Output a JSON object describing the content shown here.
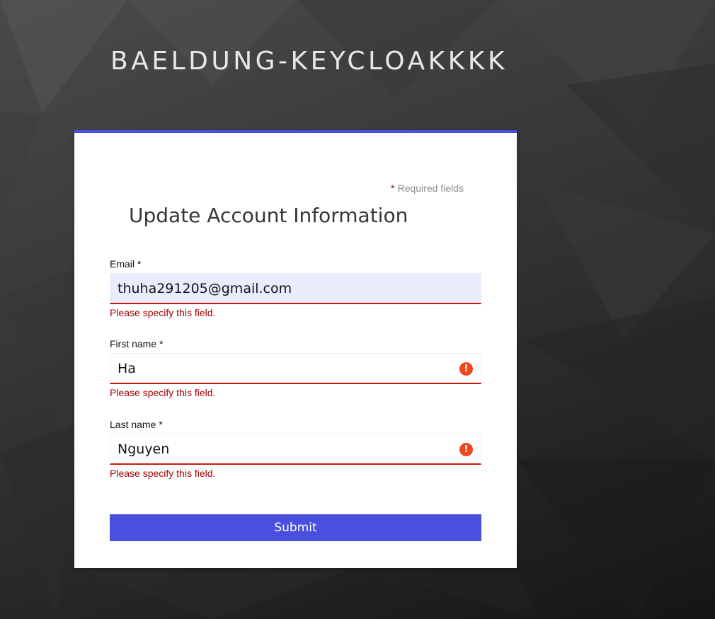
{
  "realm": {
    "name": "BAELDUNG-KEYCLOAKKKK"
  },
  "form": {
    "required_star": "*",
    "required_text": "Required fields",
    "title": "Update Account Information",
    "fields": [
      {
        "label": "Email *",
        "value": "thuha291205@gmail.com",
        "autofilled": true,
        "error_icon": false,
        "error": "Please specify this field."
      },
      {
        "label": "First name *",
        "value": "Ha",
        "autofilled": false,
        "error_icon": "!",
        "error": "Please specify this field."
      },
      {
        "label": "Last name *",
        "value": "Nguyen",
        "autofilled": false,
        "error_icon": "!",
        "error": "Please specify this field."
      }
    ],
    "submit_label": "Submit"
  },
  "colors": {
    "accent": "#4a50de",
    "error": "#c9190b",
    "error_text": "#a30000",
    "error_icon": "#f0461e",
    "autofill_bg": "#e8ecfb"
  }
}
